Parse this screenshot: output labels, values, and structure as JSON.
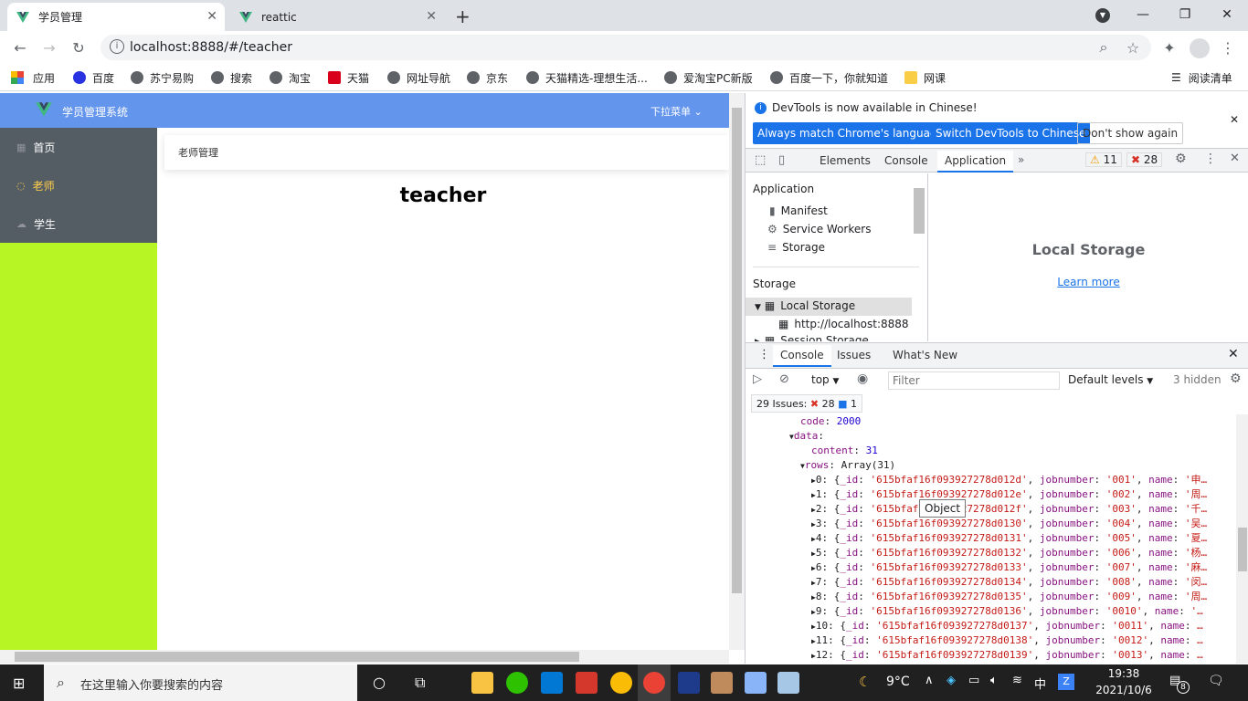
{
  "tabs": [
    {
      "title": "学员管理",
      "active": true
    },
    {
      "title": "reattic",
      "active": false
    }
  ],
  "toolbar": {
    "url": "localhost:8888/#/teacher"
  },
  "bookmarks": [
    "应用",
    "百度",
    "苏宁易购",
    "搜索",
    "淘宝",
    "天猫",
    "网址导航",
    "京东",
    "天猫精选-理想生活...",
    "爱淘宝PC新版",
    "百度一下，你就知道",
    "网课"
  ],
  "reading_list": "阅读清单",
  "app": {
    "title": "学员管理系统",
    "dropdown": "下拉菜单",
    "menu": [
      {
        "label": "首页",
        "active": false
      },
      {
        "label": "老师",
        "active": true
      },
      {
        "label": "学生",
        "active": false
      }
    ],
    "breadcrumb": "老师管理",
    "heading": "teacher"
  },
  "devtools": {
    "notice": "DevTools is now available in Chinese!",
    "btn_match": "Always match Chrome's language",
    "btn_switch": "Switch DevTools to Chinese",
    "btn_dont": "Don't show again",
    "tabs": [
      "Elements",
      "Console",
      "Application"
    ],
    "warn_count": "11",
    "error_count": "28",
    "app_section": "Application",
    "app_items": [
      "Manifest",
      "Service Workers",
      "Storage"
    ],
    "storage_section": "Storage",
    "storage_items": [
      "Local Storage",
      "http://localhost:8888",
      "Session Storage"
    ],
    "pane_title": "Local Storage",
    "learn_more": "Learn more",
    "drawer_tabs": [
      "Console",
      "Issues",
      "What's New"
    ],
    "context": "top",
    "filter_placeholder": "Filter",
    "levels": "Default levels",
    "hidden": "3 hidden",
    "issues_label": "29 Issues:",
    "issues_errors": "28",
    "issues_info": "1",
    "tooltip": "Object",
    "console_head": [
      {
        "key": "code",
        "value": "2000"
      },
      {
        "key": "data",
        "value": ""
      },
      {
        "key": "content",
        "value": "31"
      },
      {
        "key": "rows",
        "value": "Array(31)"
      }
    ],
    "rows": [
      {
        "i": "0",
        "id": "'615bfaf16f093927278d012d'",
        "job": "'001'",
        "name": "'申…"
      },
      {
        "i": "1",
        "id": "'615bfaf16f093927278d012e'",
        "job": "'002'",
        "name": "'周…"
      },
      {
        "i": "2",
        "id": "'615bfaf16f093927278d012f'",
        "job": "'003'",
        "name": "'千…"
      },
      {
        "i": "3",
        "id": "'615bfaf16f093927278d0130'",
        "job": "'004'",
        "name": "'吴…"
      },
      {
        "i": "4",
        "id": "'615bfaf16f093927278d0131'",
        "job": "'005'",
        "name": "'夏…"
      },
      {
        "i": "5",
        "id": "'615bfaf16f093927278d0132'",
        "job": "'006'",
        "name": "'杨…"
      },
      {
        "i": "6",
        "id": "'615bfaf16f093927278d0133'",
        "job": "'007'",
        "name": "'麻…"
      },
      {
        "i": "7",
        "id": "'615bfaf16f093927278d0134'",
        "job": "'008'",
        "name": "'闵…"
      },
      {
        "i": "8",
        "id": "'615bfaf16f093927278d0135'",
        "job": "'009'",
        "name": "'周…"
      },
      {
        "i": "9",
        "id": "'615bfaf16f093927278d0136'",
        "job": "'0010'",
        "name": "'…"
      },
      {
        "i": "10",
        "id": "'615bfaf16f093927278d0137'",
        "job": "'0011'",
        "name": "…"
      },
      {
        "i": "11",
        "id": "'615bfaf16f093927278d0138'",
        "job": "'0012'",
        "name": "…"
      },
      {
        "i": "12",
        "id": "'615bfaf16f093927278d0139'",
        "job": "'0013'",
        "name": "…"
      }
    ]
  },
  "taskbar": {
    "search_placeholder": "在这里输入你要搜索的内容",
    "weather": "9°C",
    "ime": "中",
    "time": "19:38",
    "date": "2021/10/6",
    "notif_count": "8"
  }
}
